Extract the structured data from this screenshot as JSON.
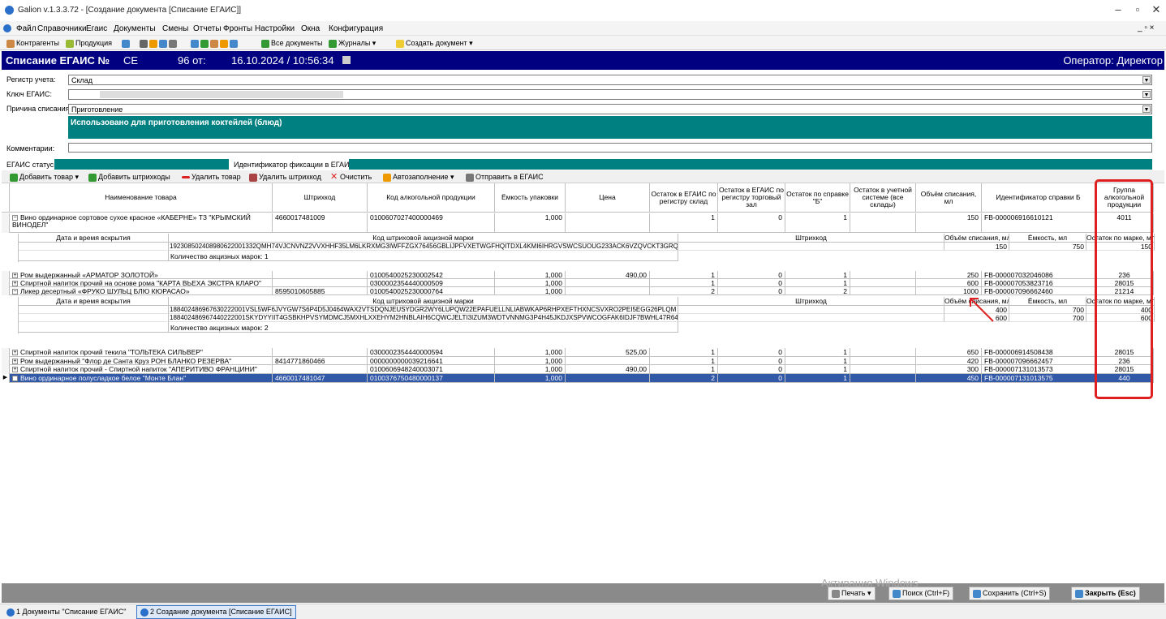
{
  "window": {
    "title": "Galion  v.1.3.3.72 - [Создание документа [Списание ЕГАИС]]"
  },
  "menu": [
    "Файл",
    "Справочники",
    "Егаис",
    "Документы",
    "Смены",
    "Отчеты",
    "Фронты",
    "Настройки",
    "Окна",
    "Конфигурация"
  ],
  "toolbar": {
    "contragents": "Контрагенты",
    "products": "Продукция",
    "all_docs": "Все документы",
    "journals": "Журналы ▾",
    "create_doc": "Создать документ ▾"
  },
  "header": {
    "title": "Списание ЕГАИС №",
    "series": "СЕ",
    "number": "96 от:",
    "datetime": "16.10.2024 / 10:56:34",
    "operator": "Оператор: Директор"
  },
  "form": {
    "register_label": "Регистр учета:",
    "register_value": "Склад",
    "key_label": "Ключ ЕГАИС:",
    "reason_label": "Причина списания:",
    "reason_value": "Приготовление",
    "reason_note": "Использовано для приготовления коктейлей (блюд)",
    "comments_label": "Комментарии:",
    "status_label": "ЕГАИС статус:",
    "fix_label": "Идентификатор фиксации в ЕГАИС:"
  },
  "actions": {
    "add_product": "Добавить товар ▾",
    "add_barcodes": "Добавить штрихкоды",
    "delete_product": "Удалить товар",
    "delete_barcode": "Удалить штрихкод",
    "clear": "Очистить",
    "autofill": "Автозаполнение ▾",
    "send": "Отправить в ЕГАИС"
  },
  "columns": [
    "Наименование товара",
    "Штрихкод",
    "Код алкогольной продукции",
    "Ёмкость упаковки",
    "Цена",
    "Остаток в ЕГАИС по регистру склад",
    "Остаток в ЕГАИС по регистру торговый зал",
    "Остаток по справке \"Б\"",
    "Остаток в учетной системе (все склады)",
    "Объём списания, мл",
    "Идентификатор справки Б",
    "Группа алкогольной продукции"
  ],
  "subcolumns": {
    "opened": "Дата и время вскрытия",
    "excise": "Код штриховой акцизной марки",
    "barcode": "Штрихкод",
    "volume": "Объём списания, мл",
    "capacity": "Ёмкость, мл",
    "rest": "Остаток по марке, мл"
  },
  "rows": [
    {
      "name": "Вино ординарное сортовое сухое красное «КАБЕРНЕ» ТЗ \"КРЫМСКИЙ ВИНОДЕЛ\"",
      "barcode": "4660017481009",
      "alc": "0100607027400000469",
      "cap": "1,000",
      "price": "",
      "r1": "1",
      "r2": "0",
      "r3": "1",
      "r4": "",
      "vol": "150",
      "fb": "FB-000006916610121",
      "group": "4011"
    },
    {
      "name": "Ром выдержанный «АРМАТОР ЗОЛОТОЙ»",
      "barcode": "",
      "alc": "0100540025230002542",
      "cap": "1,000",
      "price": "490,00",
      "r1": "1",
      "r2": "0",
      "r3": "1",
      "r4": "",
      "vol": "250",
      "fb": "FB-000007032046086",
      "group": "236"
    },
    {
      "name": "Спиртной напиток прочий на основе рома \"КАРТА ВЬЕХА ЭКСТРА КЛАРО\"",
      "barcode": "",
      "alc": "0300002354440000509",
      "cap": "1,000",
      "price": "",
      "r1": "1",
      "r2": "0",
      "r3": "1",
      "r4": "",
      "vol": "600",
      "fb": "FB-000007053823716",
      "group": "28015"
    },
    {
      "name": "Ликер десертный «ФРУКО ШУЛЬЦ БЛЮ КЮРАСАО»",
      "barcode": "8595010605885",
      "alc": "0100540025230000764",
      "cap": "1,000",
      "price": "",
      "r1": "2",
      "r2": "0",
      "r3": "2",
      "r4": "",
      "vol": "1000",
      "fb": "FB-000007096662460",
      "group": "21214"
    },
    {
      "name": "Спиртной напиток прочий текила \"ТОЛЬТЕКА СИЛЬВЕР\"",
      "barcode": "",
      "alc": "0300002354440000594",
      "cap": "1,000",
      "price": "525,00",
      "r1": "1",
      "r2": "0",
      "r3": "1",
      "r4": "",
      "vol": "650",
      "fb": "FB-000006914508438",
      "group": "28015"
    },
    {
      "name": "Ром выдержанный \"Флор де Санта Круз РОН БЛАНКО РЕЗЕРВА\"",
      "barcode": "8414771860466",
      "alc": "0000000000039216641",
      "cap": "1,000",
      "price": "",
      "r1": "1",
      "r2": "0",
      "r3": "1",
      "r4": "",
      "vol": "420",
      "fb": "FB-000007096662457",
      "group": "236"
    },
    {
      "name": "Спиртной напиток прочий - Спиртной напиток \"АПЕРИТИВО ФРАНЦИНИ\"",
      "barcode": "",
      "alc": "0100606948240003071",
      "cap": "1,000",
      "price": "490,00",
      "r1": "1",
      "r2": "0",
      "r3": "1",
      "r4": "",
      "vol": "300",
      "fb": "FB-000007131013573",
      "group": "28015"
    },
    {
      "name": "Вино ординарное полусладкое белое \"Монте Блан\"",
      "barcode": "4660017481047",
      "alc": "0100376750480000137",
      "cap": "1,000",
      "price": "",
      "r1": "2",
      "r2": "0",
      "r3": "1",
      "r4": "",
      "vol": "450",
      "fb": "FB-000007131013575",
      "group": "440"
    }
  ],
  "sub1": {
    "marks": [
      {
        "code": "192308502408980622001332QMH74VJCNVNZ2VVXHHF35LM6LKRXMG3IWFFZGX76456GBLIJPFVXETWGFHQITDXL4KMI6IHRGVSWCSUOUG233ACK6VZQVCKT3GRQ",
        "vol": "150",
        "cap": "750",
        "rest": "150"
      }
    ],
    "count_label": "Количество акцизных марок:  1"
  },
  "sub2": {
    "marks": [
      {
        "code": "188402486967630222001VSL5WF6JVYGW7S6P4D5J0464WAX2VTSDQNJEUSYDGR2WY6LUPQW22EPAFUELLNLIABWKAP6RHPXEFTHXNCSVXRO2PEI5EGG26PLQM",
        "vol": "400",
        "cap": "700",
        "rest": "400"
      },
      {
        "code": "188402486967440222001SKYDYYIIT4GSBKHPVSYMDMCJ5MXHLXXEHYM2HNBLAIH6CQWCJELTI3IZUM3WDTVNNMG3P4H45JKDJXSPVWCOGFAK6IDJF7BWHL47R64",
        "vol": "600",
        "cap": "700",
        "rest": "600"
      }
    ],
    "count_label": "Количество акцизных марок:  2"
  },
  "buttons": {
    "print": "Печать ▾",
    "search": "Поиск (Ctrl+F)",
    "save": "Сохранить (Ctrl+S)",
    "close": "Закрыть (Esc)"
  },
  "watermark": "Активация Windows",
  "taskbar": {
    "item1": "1 Документы \"Списание ЕГАИС\"",
    "item2": "2 Создание документа [Списание ЕГАИС]"
  }
}
